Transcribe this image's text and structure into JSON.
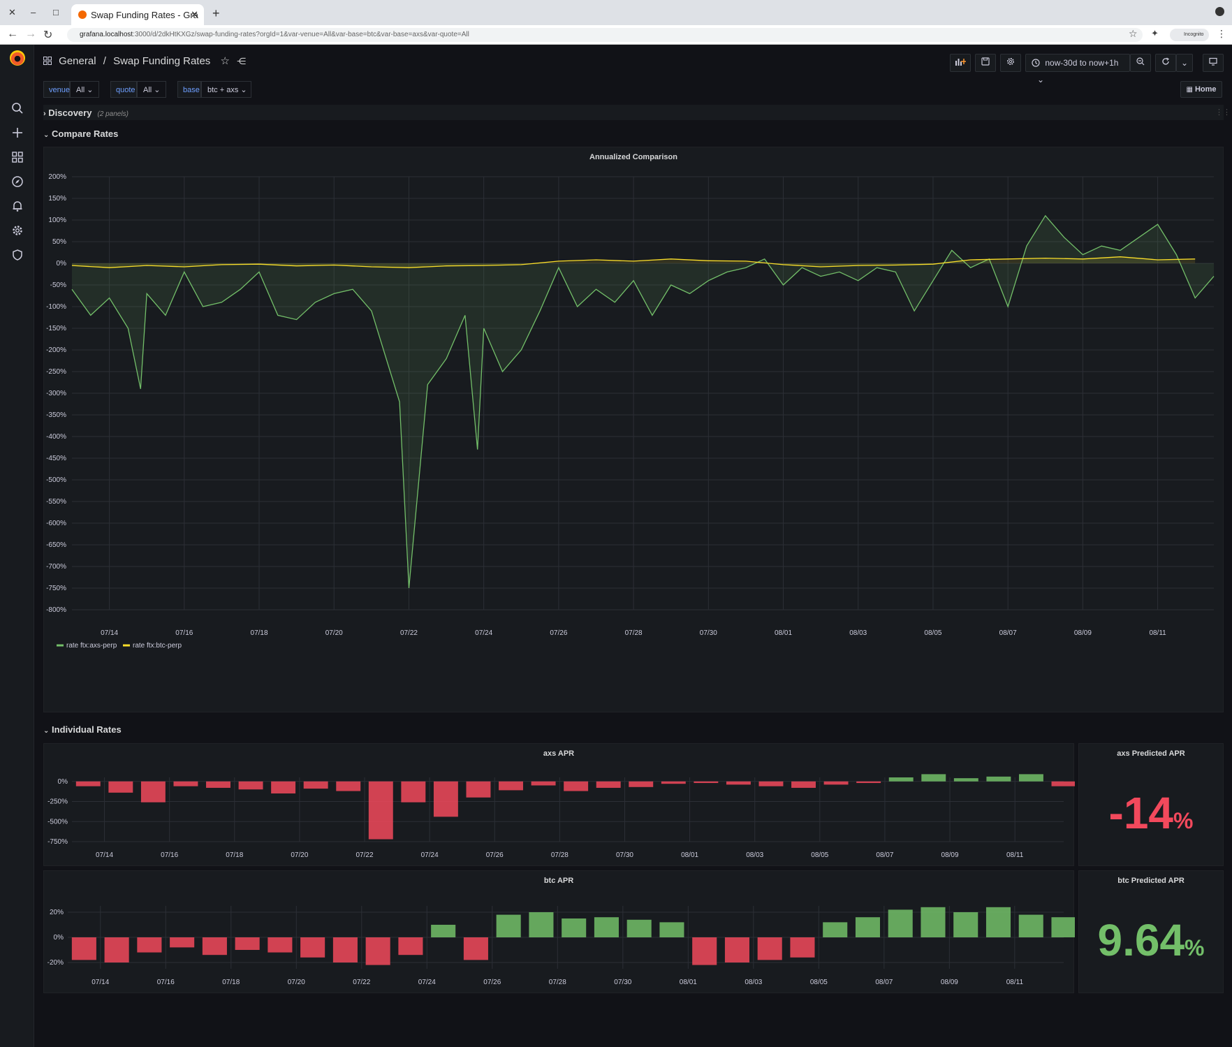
{
  "browser": {
    "tab_title": "Swap Funding Rates - Gra",
    "url_host": "grafana.localhost",
    "url_path": ":3000/d/2dkHtKXGz/swap-funding-rates?orgId=1&var-venue=All&var-base=btc&var-base=axs&var-quote=All",
    "incognito_label": "Incognito"
  },
  "header": {
    "folder": "General",
    "separator": "/",
    "dashboard_title": "Swap Funding Rates",
    "time_range": "now-30d to now+1h",
    "home_label": "Home"
  },
  "variables": [
    {
      "label": "venue",
      "value": "All"
    },
    {
      "label": "quote",
      "value": "All"
    },
    {
      "label": "base",
      "value": "btc + axs"
    }
  ],
  "rows": {
    "discovery": {
      "title": "Discovery",
      "note": "(2 panels)"
    },
    "compare": {
      "title": "Compare Rates"
    },
    "individual": {
      "title": "Individual Rates"
    }
  },
  "colors": {
    "green": "#73bf69",
    "yellow": "#fade2a",
    "red": "#f2495c",
    "panel_bg": "#181b1f",
    "grid": "#2c2f36",
    "text": "#ccccdc"
  },
  "panels": {
    "comparison": {
      "title": "Annualized Comparison"
    },
    "axs_apr": {
      "title": "axs APR"
    },
    "axs_stat": {
      "title": "axs Predicted APR",
      "value": "-14",
      "unit": "%"
    },
    "btc_apr": {
      "title": "btc APR"
    },
    "btc_stat": {
      "title": "btc Predicted APR",
      "value": "9.64",
      "unit": "%"
    }
  },
  "chart_data": [
    {
      "type": "line",
      "title": "Annualized Comparison",
      "ylim": [
        -800,
        200
      ],
      "y_ticks": [
        200,
        150,
        100,
        50,
        0,
        -50,
        -100,
        -150,
        -200,
        -250,
        -300,
        -350,
        -400,
        -450,
        -500,
        -550,
        -600,
        -650,
        -700,
        -750,
        -800
      ],
      "y_tick_labels": [
        "200%",
        "150%",
        "100%",
        "50%",
        "0%",
        "-50%",
        "-100%",
        "-150%",
        "-200%",
        "-250%",
        "-300%",
        "-350%",
        "-400%",
        "-450%",
        "-500%",
        "-550%",
        "-600%",
        "-650%",
        "-700%",
        "-750%",
        "-800%"
      ],
      "x_ticks": [
        "07/14",
        "07/16",
        "07/18",
        "07/20",
        "07/22",
        "07/24",
        "07/26",
        "07/28",
        "07/30",
        "08/01",
        "08/03",
        "08/05",
        "08/07",
        "08/09",
        "08/11"
      ],
      "grid": true,
      "legend": "bottom-left",
      "series": [
        {
          "name": "rate ftx:axs-perp",
          "color": "#73bf69",
          "fill": true,
          "x": [
            "07/13 00:00",
            "07/13 12:00",
            "07/14 00:00",
            "07/14 12:00",
            "07/14 20:00",
            "07/15 00:00",
            "07/15 12:00",
            "07/16 00:00",
            "07/16 12:00",
            "07/17 00:00",
            "07/17 12:00",
            "07/18 00:00",
            "07/18 12:00",
            "07/19 00:00",
            "07/19 12:00",
            "07/20 00:00",
            "07/20 12:00",
            "07/21 00:00",
            "07/21 06:00",
            "07/21 18:00",
            "07/22 00:00",
            "07/22 12:00",
            "07/23 00:00",
            "07/23 12:00",
            "07/23 20:00",
            "07/24 00:00",
            "07/24 12:00",
            "07/25 00:00",
            "07/25 12:00",
            "07/26 00:00",
            "07/26 12:00",
            "07/27 00:00",
            "07/27 12:00",
            "07/28 00:00",
            "07/28 12:00",
            "07/29 00:00",
            "07/29 12:00",
            "07/30 00:00",
            "07/30 12:00",
            "07/31 00:00",
            "07/31 12:00",
            "08/01 00:00",
            "08/01 12:00",
            "08/02 00:00",
            "08/02 12:00",
            "08/03 00:00",
            "08/03 12:00",
            "08/04 00:00",
            "08/04 12:00",
            "08/05 00:00",
            "08/05 12:00",
            "08/06 00:00",
            "08/06 12:00",
            "08/07 00:00",
            "08/07 12:00",
            "08/08 00:00",
            "08/08 12:00",
            "08/09 00:00",
            "08/09 12:00",
            "08/10 00:00",
            "08/10 12:00",
            "08/11 00:00",
            "08/11 12:00",
            "08/12 00:00",
            "08/12 12:00"
          ],
          "y": [
            -60,
            -120,
            -80,
            -150,
            -290,
            -70,
            -120,
            -20,
            -100,
            -90,
            -60,
            -20,
            -120,
            -130,
            -90,
            -70,
            -60,
            -110,
            -180,
            -320,
            -750,
            -280,
            -220,
            -120,
            -430,
            -150,
            -250,
            -200,
            -110,
            -10,
            -100,
            -60,
            -90,
            -40,
            -120,
            -50,
            -70,
            -40,
            -20,
            -10,
            10,
            -50,
            -10,
            -30,
            -20,
            -40,
            -10,
            -20,
            -110,
            -40,
            30,
            -10,
            10,
            -100,
            40,
            110,
            60,
            20,
            40,
            30,
            60,
            90,
            20,
            -80,
            -30
          ]
        },
        {
          "name": "rate ftx:btc-perp",
          "color": "#fade2a",
          "fill": true,
          "x": [
            "07/13 00:00",
            "07/14 00:00",
            "07/15 00:00",
            "07/16 00:00",
            "07/17 00:00",
            "07/18 00:00",
            "07/19 00:00",
            "07/20 00:00",
            "07/21 00:00",
            "07/22 00:00",
            "07/23 00:00",
            "07/24 00:00",
            "07/25 00:00",
            "07/26 00:00",
            "07/27 00:00",
            "07/28 00:00",
            "07/29 00:00",
            "07/30 00:00",
            "07/31 00:00",
            "08/01 00:00",
            "08/02 00:00",
            "08/03 00:00",
            "08/04 00:00",
            "08/05 00:00",
            "08/06 00:00",
            "08/07 00:00",
            "08/08 00:00",
            "08/09 00:00",
            "08/10 00:00",
            "08/11 00:00",
            "08/12 00:00"
          ],
          "y": [
            -5,
            -10,
            -5,
            -8,
            -3,
            -2,
            -6,
            -4,
            -8,
            -10,
            -6,
            -5,
            -3,
            5,
            8,
            5,
            10,
            6,
            5,
            -3,
            -8,
            -5,
            -4,
            -2,
            8,
            10,
            12,
            10,
            15,
            8,
            10
          ]
        }
      ]
    },
    {
      "type": "bar",
      "title": "axs APR",
      "ylim": [
        -750,
        50
      ],
      "y_ticks": [
        0,
        -250,
        -500,
        -750
      ],
      "y_tick_labels": [
        "0%",
        "-250%",
        "-500%",
        "-750%"
      ],
      "x_ticks": [
        "07/14",
        "07/16",
        "07/18",
        "07/20",
        "07/22",
        "07/24",
        "07/26",
        "07/28",
        "07/30",
        "08/01",
        "08/03",
        "08/05",
        "08/07",
        "08/09",
        "08/11"
      ],
      "x": [
        "07/13",
        "07/14",
        "07/15",
        "07/16",
        "07/17",
        "07/18",
        "07/19",
        "07/20",
        "07/21",
        "07/22",
        "07/23",
        "07/24",
        "07/25",
        "07/26",
        "07/27",
        "07/28",
        "07/29",
        "07/30",
        "07/31",
        "08/01",
        "08/02",
        "08/03",
        "08/04",
        "08/05",
        "08/06",
        "08/07",
        "08/08",
        "08/09",
        "08/10",
        "08/11",
        "08/12"
      ],
      "values": [
        -60,
        -140,
        -260,
        -60,
        -80,
        -100,
        -150,
        -90,
        -120,
        -720,
        -260,
        -440,
        -200,
        -110,
        -50,
        -120,
        -80,
        -70,
        -30,
        -20,
        -40,
        -60,
        -80,
        -40,
        -20,
        50,
        90,
        40,
        60,
        90,
        -60
      ],
      "colors": {
        "positive": "#73bf69",
        "negative": "#f2495c"
      }
    },
    {
      "type": "bar",
      "title": "btc APR",
      "ylim": [
        -25,
        25
      ],
      "y_ticks": [
        20,
        0,
        -20
      ],
      "y_tick_labels": [
        "20%",
        "0%",
        "-20%"
      ],
      "x_ticks": [
        "07/14",
        "07/16",
        "07/18",
        "07/20",
        "07/22",
        "07/24",
        "07/26",
        "07/28",
        "07/30",
        "08/01",
        "08/03",
        "08/05",
        "08/07",
        "08/09",
        "08/11"
      ],
      "x": [
        "07/13",
        "07/14",
        "07/15",
        "07/16",
        "07/17",
        "07/18",
        "07/19",
        "07/20",
        "07/21",
        "07/22",
        "07/23",
        "07/24",
        "07/25",
        "07/26",
        "07/27",
        "07/28",
        "07/29",
        "07/30",
        "07/31",
        "08/01",
        "08/02",
        "08/03",
        "08/04",
        "08/05",
        "08/06",
        "08/07",
        "08/08",
        "08/09",
        "08/10",
        "08/11",
        "08/12"
      ],
      "values": [
        -18,
        -20,
        -12,
        -8,
        -14,
        -10,
        -12,
        -16,
        -20,
        -22,
        -14,
        10,
        -18,
        18,
        20,
        15,
        16,
        14,
        12,
        -22,
        -20,
        -18,
        -16,
        12,
        16,
        22,
        24,
        20,
        24,
        18,
        16
      ],
      "colors": {
        "positive": "#73bf69",
        "negative": "#f2495c"
      }
    }
  ]
}
